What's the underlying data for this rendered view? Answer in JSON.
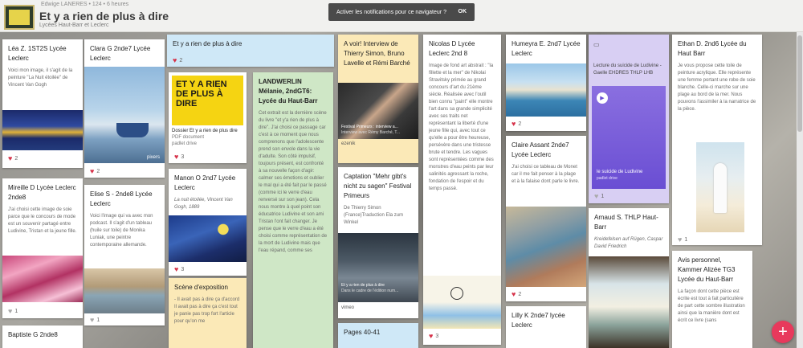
{
  "header": {
    "meta": "Edwige LANERES  •  124  •  6 heures",
    "title": "Et y a rien de plus à dire",
    "subtitle": "Lycées Haut-Barr et Leclerc"
  },
  "notification": {
    "text": "Activer les notifications pour ce navigateur ?",
    "ok_label": "OK"
  },
  "cards": {
    "c1": {
      "title": "Léa Z. 1ST2S Lycée Leclerc",
      "body": "Voici mon image, il s'agit de la peinture \"La Nuit étoilée\" de Vincent Van Gogh",
      "likes": "2"
    },
    "c2": {
      "title": "Mireille D Lycée Leclerc 2nde8",
      "body": "J'ai choisi cette image de soie parce que le concours de mode est un souvenir partagé entre Ludivine, Tristan et la jeune fille.",
      "likes": "1"
    },
    "c3": {
      "title": "Baptiste G 2nde8"
    },
    "c4": {
      "title": "Clara G 2nde7 Lycée Leclerc",
      "likes": "2",
      "img_label": "pixers"
    },
    "c5": {
      "title": "Elise S - 2nde8 Lycée Leclerc",
      "body": "Voici l'image qui va avec mon podcast. Il s'agit d'un tableau (huile sur toile) de Monika Luniak, une peintre contemporaine allemande.",
      "likes": "1"
    },
    "c6": {
      "title": "Et y a rien de plus à dire",
      "likes": "2"
    },
    "c7": {
      "poster_text": "ET Y A RIEN DE PLUS À DIRE",
      "doc_title": "Dossier Et y a rien de plus dire",
      "doc_type": "PDF document",
      "doc_source": "padlet drive",
      "likes": "3"
    },
    "c8": {
      "title": "Manon O 2nd7 Lycée Leclerc",
      "body": "La nuit étoilée, Vincent Van Gogh, 1889",
      "likes": "3"
    },
    "c9": {
      "title": "Scène d'exposition",
      "body": "- Il avait pas à dire ça d'accord Il avait pas à dire ça c'est tout je panie pas trop fort l'article pour qu'on me"
    },
    "c10": {
      "title": "LANDWERLIN Mélanie, 2ndGT6: Lycée du Haut-Barr",
      "body": "Cet extrait est la dernière scène du livre \"et y'a rien de plus à dire\". J'ai choisi ce passage car c'est à ce moment que nous comprenons que l'adolescente prend son envole dans la vie d'adulte. Son côté impulsif, toujours présent, est confronté à sa nouvelle façon d'agir: calmer ses émotions et oublier le mal qui a été fait par le passé (comme ici le verre d'eau renversé sur son jean). Cela nous montre à quel point son éducatrice Ludivine et son ami Tristan l'ont fait changer. Je pense que le verre d'eau a été choisi comme représentation de la mort de Ludivine mais que l'eau répand, comme ses"
    },
    "c11": {
      "title": "A voir! Interview de Thierry Simon, Bruno Lavelle et Rémi Barché",
      "caption": "Festival Primeurs : interview a...",
      "caption2": "Interview avec Rémy Barché, T...",
      "source": "ezenik"
    },
    "c12": {
      "title": "Captation \"Mehr gibt's nicht zu sagen\" Festival Primeurs",
      "body": "De Thierry Simon (France)Traduction Ela zum Winkel",
      "caption": "Et y a rien de plus à dire",
      "caption2": "Dans le cadre de l'édition num...",
      "source": "vimeo"
    },
    "c13": {
      "title": "Pages 40-41"
    },
    "c14": {
      "title": "Nicolas D Lycée Leclerc 2nd 8",
      "body": "Image de fond art abstrait : \"la fillette et la mer\" de Nikolai Stravitsky primée au grand concours d'art du 21ème siècle. Réalisée avec l'outil bien connu \"paint\" elle montre l'art dans sa grande simplicité avec ses traits net représentant la liberté d'une jeune fille qui, avec tout ce qu'elle a pour être heureuse, persévère dans une tristesse brute et tendre. Les vagues sont représentées comme des monstres d'eau peints par leur salinités agressant la roche, fondation de l'espoir et du temps passé.",
      "likes": "3"
    },
    "c15": {
      "title": "Humeyra E. 2nd7 Lycée Leclerc",
      "likes": "2"
    },
    "c16": {
      "title": "Claire Assant 2nde7 Lycée Leclerc",
      "body": "J'ai choisi ce tableau de Monet car il me fait penser à la plage et à la falaise dont parle le livre.",
      "likes": "2"
    },
    "c17": {
      "title": "Lilly K 2nde7 lycée Leclerc"
    },
    "c18": {
      "title": "Lecture du suicide de Ludivine - Gaelle EHDRES THLP LHB",
      "audio_title": "le suicide de Ludivine",
      "audio_source": "padlet drive",
      "likes": "1"
    },
    "c19": {
      "title": "Arnaud S. THLP Haut-Barr",
      "body": "Kreidefelsen auf Rügen, Caspar David Friedrich"
    },
    "c20": {
      "title": "Ethan D. 2nd6 Lycée du Haut Barr",
      "body": "Je vous propose cette toile de peinture acrylique. Elle représente une femme portant une robe de soie blanche. Celle-ci marche sur une plage au bord de la mer. Nous pouvons l'assimiler à la narratrice de la pièce.",
      "likes": "1"
    },
    "c21": {
      "title": "Avis personnel, Kammer Alizée TG3 Lycée du Haut-Barr",
      "body": "La façon dont cette pièce est écrite est tout à fait particulière de part cette sombre illustration ainsi que la manière dont est écrit ce livre (sans"
    }
  },
  "colors": {
    "accent": "#e8395c",
    "heart": "#d6334a",
    "blue_card": "#cfe8f7",
    "green_card": "#cfe7c6",
    "yellow_card": "#fbe9b7",
    "purple_card": "#d8cff3",
    "topbar": "#f1f1ef"
  },
  "icons": {
    "heart": "heart-icon",
    "add": "plus-icon",
    "play": "play-icon",
    "doc": "document-icon"
  },
  "fab_label": "+"
}
